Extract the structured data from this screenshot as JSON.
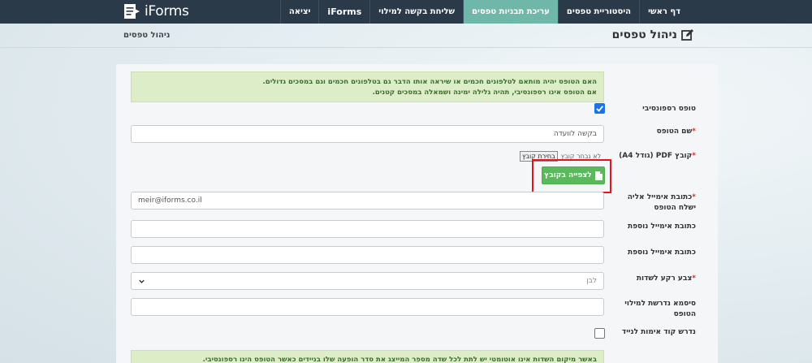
{
  "app": {
    "logo_text": "iForms"
  },
  "nav": {
    "items": [
      {
        "label": "דף ראשי",
        "active": false
      },
      {
        "label": "היסטוריית טפסים",
        "active": false
      },
      {
        "label": "עריכת תבניות טפסים",
        "active": true
      },
      {
        "label": "שליחת בקשה למילוי",
        "active": false
      },
      {
        "label": "iForms",
        "active": false
      },
      {
        "label": "יציאה",
        "active": false
      }
    ]
  },
  "header": {
    "title": "ניהול טפסים",
    "breadcrumb": "ניהול טפסים"
  },
  "form": {
    "responsive_notice_line1": "האם הטופס יהיה מותאם לטלפונים חכמים או שיראה אותו הדבר גם בטלפונים חכמים וגם במסכים גדולים.",
    "responsive_notice_line2": "אם הטופס אינו רספונסיבי, תהיה גלילה ימינה ושמאלה במסכים קטנים.",
    "responsive_label": "טופס רספונסיבי",
    "responsive_checked": true,
    "form_name_label": "שם הטופס",
    "form_name_value": "בקשה לוועדה",
    "pdf_label": "קובץ PDF (גודל A4)",
    "choose_file_label": "בחירת קובץ",
    "no_file_label": "לא נבחר קובץ",
    "view_file_label": "לצפייה בקובץ",
    "email_label_line1": "כתובת אימייל אליה",
    "email_label_line2": "ישלח הטופס",
    "email_value": "meir@iforms.co.il",
    "extra_email1_label": "כתובת אימייל נוספת",
    "extra_email1_value": "",
    "extra_email2_label": "כתובת אימייל נוספת",
    "extra_email2_value": "",
    "bg_color_label": "צבע רקע לשדות",
    "bg_color_value": "לבן",
    "password_label_line1": "סיסמא נדרשת למילוי",
    "password_label_line2": "הטופס",
    "password_value": "",
    "mobile_code_label": "נדרש קוד אימות לנייד",
    "mobile_code_checked": false,
    "field_position_notice": "באשר מיקום השדות אינו אוטומטי יש לתת לכל שדה מספר המייצג את סדר הופעה שלו בניידים כאשר הטופס הינו רספונסיבי.",
    "required_mark": "*"
  },
  "colors": {
    "topbar": "#2b3a48",
    "active_tab": "#6fb7a8",
    "success": "#5cb85c",
    "highlight": "#e3141b"
  }
}
